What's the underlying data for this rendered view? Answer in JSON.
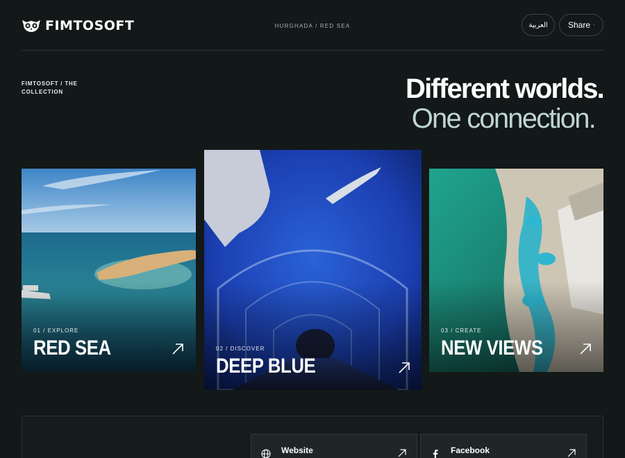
{
  "brand": {
    "name": "FIMTOSOFT",
    "logo_icon": "owl-icon"
  },
  "header": {
    "location": "HURGHADA / RED SEA",
    "language_button": "العربية",
    "share_button": "Share"
  },
  "intro": {
    "collection_label": "FIMTOSOFT / THE COLLECTION",
    "headline_line1": "Different worlds.",
    "headline_line2": "One connection."
  },
  "cards": [
    {
      "kicker": "01 / EXPLORE",
      "title": "RED SEA",
      "icon": "arrow-up-right-icon"
    },
    {
      "kicker": "02 / DISCOVER",
      "title": "DEEP BLUE",
      "icon": "arrow-up-right-icon"
    },
    {
      "kicker": "03 / CREATE",
      "title": "NEW VIEWS",
      "icon": "arrow-up-right-icon"
    }
  ],
  "links": [
    {
      "label": "Website",
      "icon": "globe-icon"
    },
    {
      "label": "Facebook",
      "icon": "facebook-icon"
    }
  ],
  "colors": {
    "background": "#131819",
    "headline_accent": "#bed6cf",
    "border": "#2c3335"
  }
}
